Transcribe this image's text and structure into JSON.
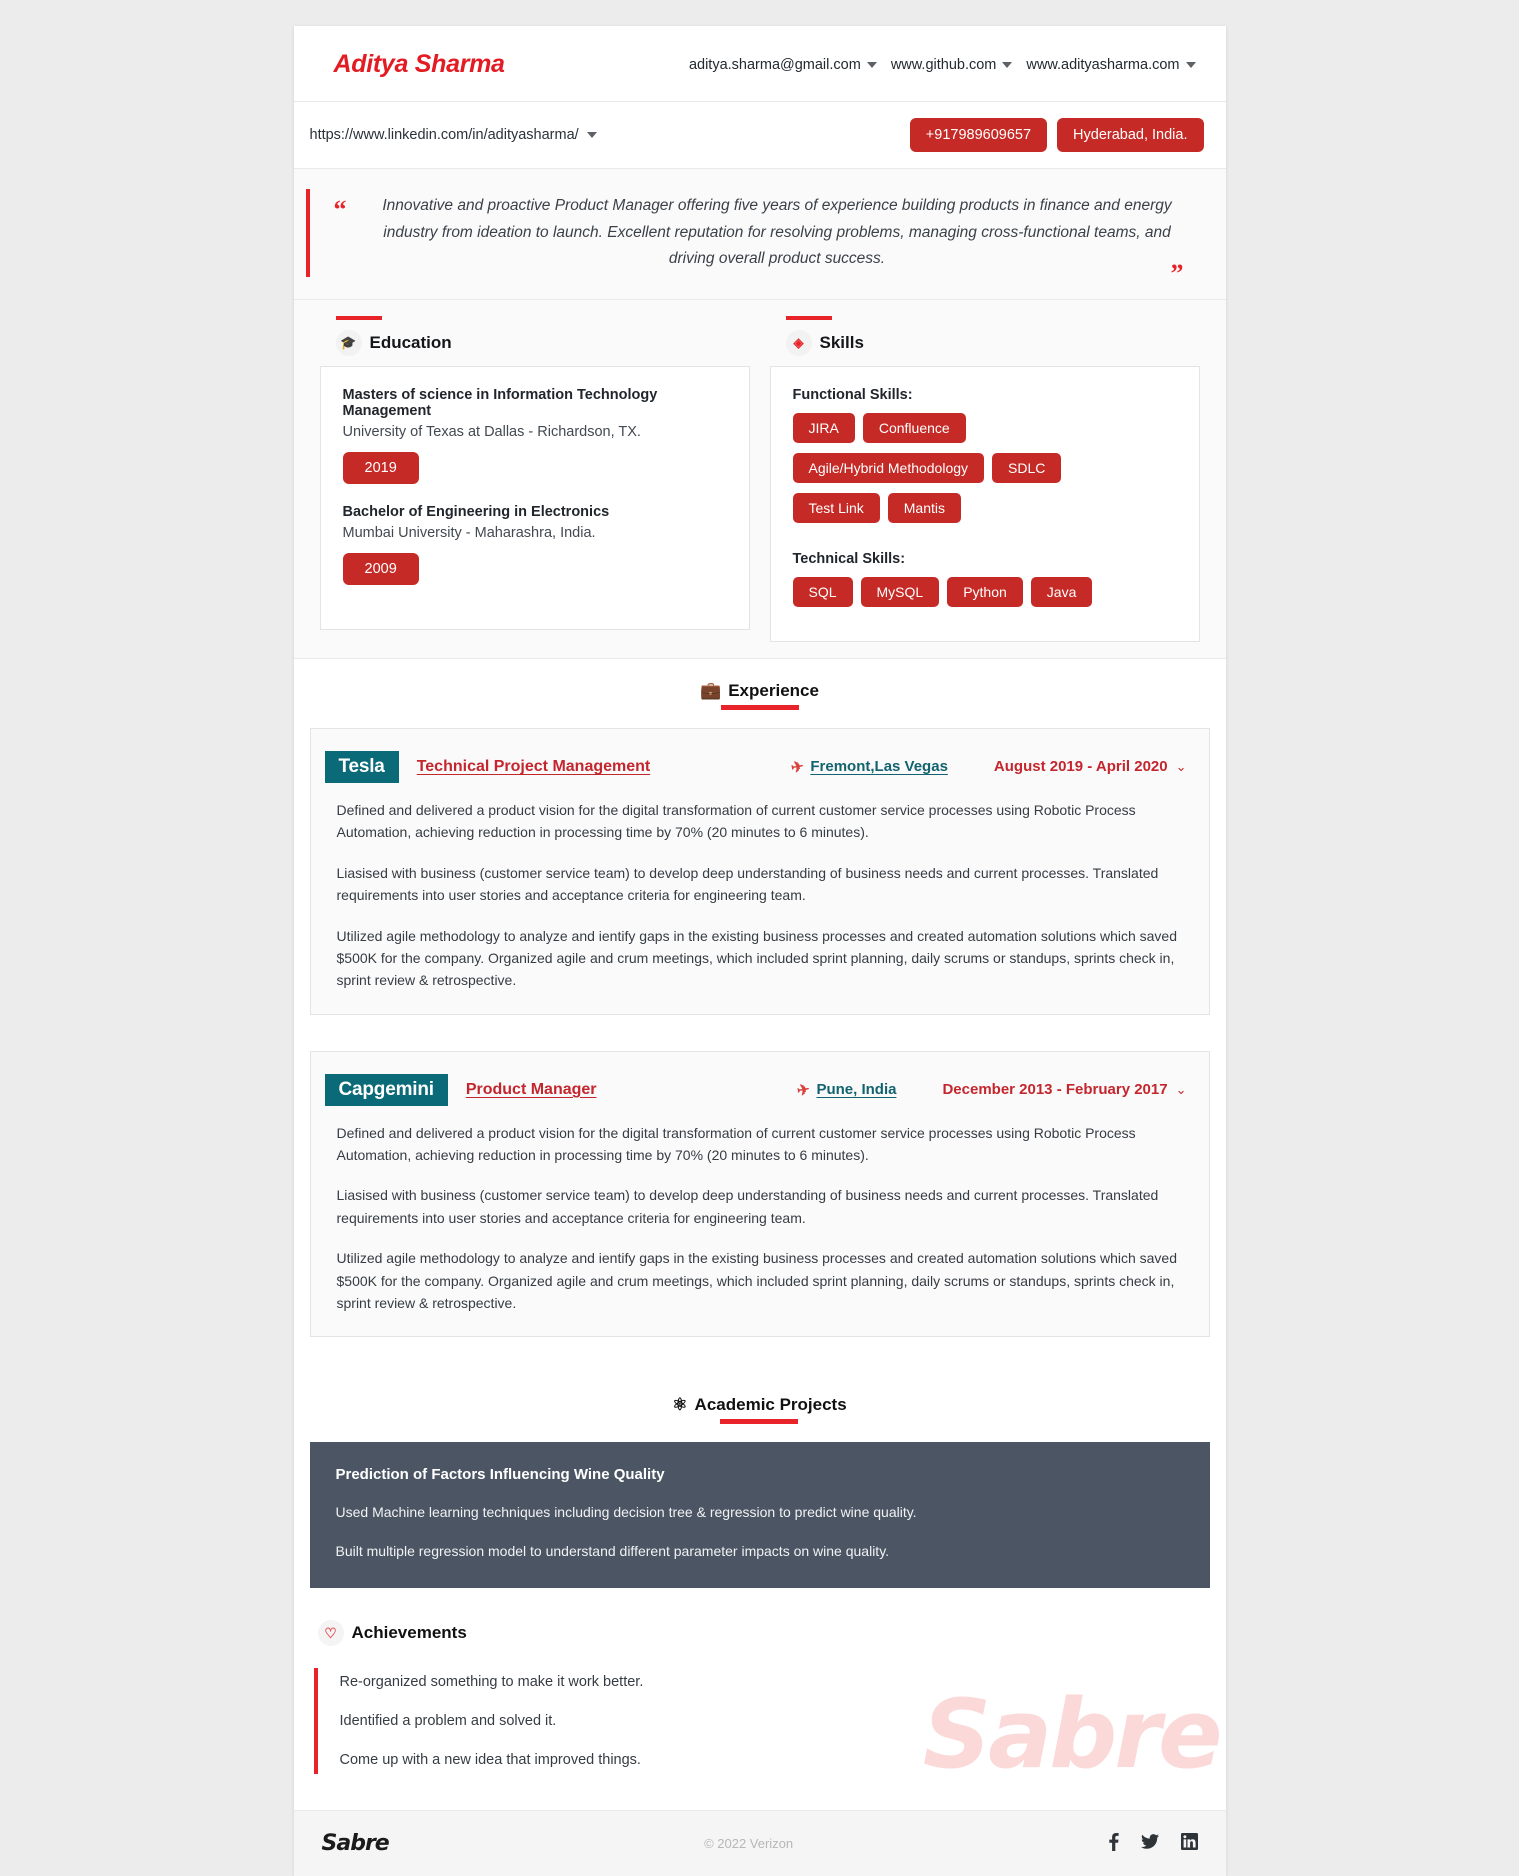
{
  "header": {
    "name": "Aditya Sharma",
    "links": [
      {
        "label": "aditya.sharma@gmail.com",
        "icon": "chevron-down-icon"
      },
      {
        "label": "www.github.com",
        "icon": "chevron-down-icon"
      },
      {
        "label": "www.adityasharma.com",
        "icon": "chevron-down-icon"
      }
    ]
  },
  "subheader": {
    "linkedin_url": "https://www.linkedin.com/in/adityasharma/",
    "phone": "+917989609657",
    "location": "Hyderabad, India."
  },
  "summary": {
    "open_quote": "“",
    "close_quote": "”",
    "text": "Innovative and proactive Product Manager offering five years of experience building products in finance and energy industry from ideation to launch. Excellent reputation for resolving problems, managing cross-functional teams, and driving overall product success."
  },
  "education": {
    "title": "Education",
    "icon": "graduation-cap-icon",
    "items": [
      {
        "degree": "Masters of science in Information Technology Management",
        "school": "University of Texas at Dallas - Richardson, TX.",
        "year": "2019"
      },
      {
        "degree": "Bachelor of Engineering in Electronics",
        "school": "Mumbai University - Maharashra, India.",
        "year": "2009"
      }
    ]
  },
  "skills": {
    "title": "Skills",
    "icon": "skills-cluster-icon",
    "groups": [
      {
        "label": "Functional Skills:",
        "rows": [
          [
            "JIRA",
            "Confluence"
          ],
          [
            "Agile/Hybrid Methodology",
            "SDLC"
          ],
          [
            "Test Link",
            "Mantis"
          ]
        ]
      },
      {
        "label": "Technical Skills:",
        "rows": [
          [
            "SQL",
            "MySQL",
            "Python",
            "Java"
          ]
        ]
      }
    ]
  },
  "experience": {
    "title": "Experience",
    "icon": "briefcase-icon",
    "jobs": [
      {
        "company": "Tesla",
        "role": "Technical Project Management",
        "location": "Fremont,Las Vegas",
        "location_icon": "plane-icon",
        "dates": "August 2019 - April 2020",
        "chevron": "chevron-down-icon",
        "paragraphs": [
          "Defined and delivered a product vision for the digital transformation of current customer service processes using Robotic Process Automation, achieving reduction in processing time by 70% (20 minutes to 6 minutes).",
          "Liasised with business (customer service team) to develop deep understanding of business needs and current processes. Translated requirements into user stories and acceptance criteria for engineering team.",
          "Utilized agile methodology to analyze and ientify gaps in the existing business processes and created automation solutions which saved $500K for the company. Organized agile and crum meetings, which included sprint planning, daily scrums or standups, sprints check in, sprint review & retrospective."
        ]
      },
      {
        "company": "Capgemini",
        "role": "Product Manager",
        "location": "Pune, India",
        "location_icon": "plane-icon",
        "dates": "December 2013 - February 2017",
        "chevron": "chevron-down-icon",
        "paragraphs": [
          "Defined and delivered a product vision for the digital transformation of current customer service processes using Robotic Process Automation, achieving reduction in processing time by 70% (20 minutes to 6 minutes).",
          "Liasised with business (customer service team) to develop deep understanding of business needs and current processes. Translated requirements into user stories and acceptance criteria for engineering team.",
          "Utilized agile methodology to analyze and ientify gaps in the existing business processes and created automation solutions which saved $500K for the company. Organized agile and crum meetings, which included sprint planning, daily scrums or standups, sprints check in, sprint review & retrospective."
        ]
      }
    ]
  },
  "projects": {
    "title": "Academic Projects",
    "icon": "molecule-icon",
    "items": [
      {
        "title": "Prediction of Factors Influencing Wine Quality",
        "paragraphs": [
          "Used Machine learning techniques including decision tree & regression to predict wine quality.",
          "Built multiple regression model to understand different parameter impacts on wine quality."
        ]
      }
    ]
  },
  "achievements": {
    "title": "Achievements",
    "icon": "heart-icon",
    "items": [
      "Re-organized something to make it work better.",
      "Identified a problem and solved it.",
      "Come up with a new idea that improved things."
    ],
    "watermark": "Sabre"
  },
  "footer": {
    "logo": "Sabre",
    "copyright": "© 2022 Verizon",
    "social": [
      {
        "name": "facebook-icon",
        "glyph": "f"
      },
      {
        "name": "twitter-icon",
        "glyph": "🐦"
      },
      {
        "name": "linkedin-icon",
        "glyph": "in"
      }
    ]
  },
  "colors": {
    "accent_red": "#e8232a",
    "pill_red": "#c52a26",
    "teal": "#0b6a78",
    "slate": "#4c5563"
  }
}
